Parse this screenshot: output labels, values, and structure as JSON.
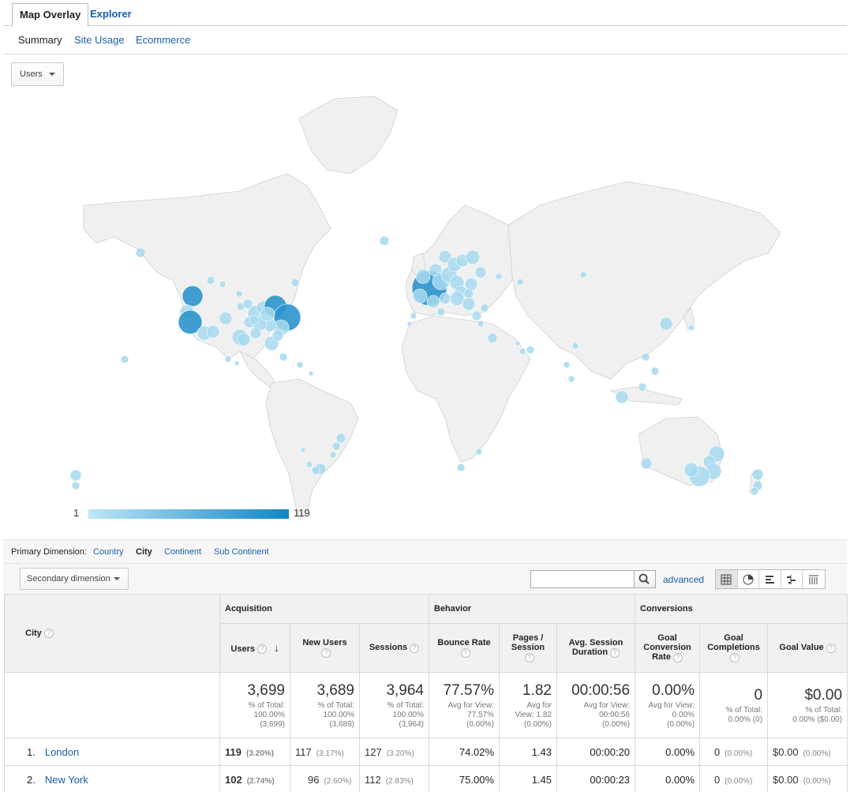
{
  "tabs": {
    "map_overlay": "Map Overlay",
    "explorer": "Explorer"
  },
  "subtabs": {
    "summary": "Summary",
    "site_usage": "Site Usage",
    "ecommerce": "Ecommerce"
  },
  "metric_selector": "Users",
  "legend": {
    "min": "1",
    "max": "119"
  },
  "primary_dimension": {
    "label": "Primary Dimension:",
    "country": "Country",
    "city": "City",
    "continent": "Continent",
    "sub_continent": "Sub Continent"
  },
  "secondary_dimension": "Secondary dimension",
  "search": {
    "value": "",
    "advanced": "advanced"
  },
  "colors": {
    "bubble_light": "#a6d9ee",
    "bubble_dark": "#2b93cc",
    "land": "#f0f0f0",
    "border": "#cfcfcf"
  },
  "table": {
    "city_header": "City",
    "groups": {
      "acquisition": "Acquisition",
      "behavior": "Behavior",
      "conversions": "Conversions"
    },
    "columns": {
      "users": "Users",
      "new_users": "New Users",
      "sessions": "Sessions",
      "bounce_rate": "Bounce Rate",
      "pages_session": "Pages / Session",
      "avg_session": "Avg. Session Duration",
      "goal_conv": "Goal Conversion Rate",
      "goal_comp": "Goal Completions",
      "goal_value": "Goal Value"
    },
    "totals": {
      "users": {
        "value": "3,699",
        "l1": "% of Total:",
        "l2": "100.00%",
        "l3": "(3,699)"
      },
      "new_users": {
        "value": "3,689",
        "l1": "% of Total:",
        "l2": "100.00%",
        "l3": "(3,689)"
      },
      "sessions": {
        "value": "3,964",
        "l1": "% of Total:",
        "l2": "100.00%",
        "l3": "(3,964)"
      },
      "bounce_rate": {
        "value": "77.57%",
        "l1": "Avg for View:",
        "l2": "77.57%",
        "l3": "(0.00%)"
      },
      "pages_session": {
        "value": "1.82",
        "l1": "Avg for",
        "l2": "View: 1.82",
        "l3": "(0.00%)"
      },
      "avg_session": {
        "value": "00:00:56",
        "l1": "Avg for View:",
        "l2": "00:00:56",
        "l3": "(0.00%)"
      },
      "goal_conv": {
        "value": "0.00%",
        "l1": "Avg for View:",
        "l2": "0.00%",
        "l3": "(0.00%)"
      },
      "goal_comp": {
        "value": "0",
        "l1": "% of Total:",
        "l2": "0.00% (0)",
        "l3": ""
      },
      "goal_value": {
        "value": "$0.00",
        "l1": "% of Total:",
        "l2": "0.00% ($0.00)",
        "l3": ""
      }
    },
    "rows": [
      {
        "idx": "1.",
        "city": "London",
        "users": "119",
        "users_pct": "(3.20%)",
        "new_users": "117",
        "new_users_pct": "(3.17%)",
        "sessions": "127",
        "sessions_pct": "(3.20%)",
        "bounce": "74.02%",
        "pages": "1.43",
        "duration": "00:00:20",
        "conv": "0.00%",
        "comp": "0",
        "comp_pct": "(0.00%)",
        "value": "$0.00",
        "value_pct": "(0.00%)"
      },
      {
        "idx": "2.",
        "city": "New York",
        "users": "102",
        "users_pct": "(2.74%)",
        "new_users": "96",
        "new_users_pct": "(2.60%)",
        "sessions": "112",
        "sessions_pct": "(2.83%)",
        "bounce": "75.00%",
        "pages": "1.45",
        "duration": "00:00:23",
        "conv": "0.00%",
        "comp": "0",
        "comp_pct": "(0.00%)",
        "value": "$0.00",
        "value_pct": "(0.00%)"
      }
    ]
  }
}
